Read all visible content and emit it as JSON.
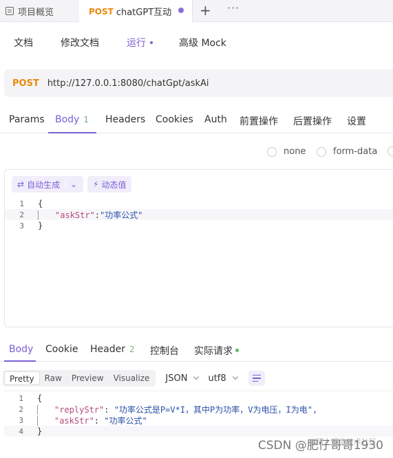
{
  "tabs": {
    "overview_label": "项目概览",
    "active_method": "POST",
    "active_title": "chatGPT互动",
    "add_label": "+",
    "more_label": "···"
  },
  "subtabs": [
    "文档",
    "修改文档",
    "运行",
    "高级 Mock"
  ],
  "request": {
    "method": "POST",
    "url": "http://127.0.0.1:8080/chatGpt/askAi"
  },
  "reqtabs": {
    "params": "Params",
    "body": "Body",
    "body_count": "1",
    "headers": "Headers",
    "cookies": "Cookies",
    "auth": "Auth",
    "pre": "前置操作",
    "post": "后置操作",
    "settings": "设置"
  },
  "body_types": [
    "none",
    "form-data"
  ],
  "body_toolbar": {
    "auto_gen": "自动生成",
    "dynamic": "动态值"
  },
  "request_body": {
    "line_numbers": [
      "1",
      "2",
      "3"
    ],
    "open": "{",
    "key": "\"askStr\"",
    "colon": ":",
    "value": "\"功率公式\"",
    "close": "}"
  },
  "response_tabs": {
    "body": "Body",
    "cookie": "Cookie",
    "header": "Header",
    "header_count": "2",
    "console": "控制台",
    "actual": "实际请求"
  },
  "format_options": [
    "Pretty",
    "Raw",
    "Preview",
    "Visualize"
  ],
  "format_selected": "Pretty",
  "format_type": "JSON",
  "encoding": "utf8",
  "response_body": {
    "line_numbers": [
      "1",
      "2",
      "3",
      "4"
    ],
    "open": "{",
    "key1": "\"replyStr\"",
    "value1": "\"功率公式是P=V*I，其中P为功率，V为电压，I为电\",",
    "key2": "\"askStr\"",
    "value2": "\"功率公式\"",
    "close": "}"
  },
  "watermark": "CSDN @肥仔哥哥1930",
  "watermark_faint": "@稀土掘金技术社区",
  "colors": {
    "accent": "#7a5fd6",
    "post": "#e8890c",
    "count": "#7bb37b"
  }
}
